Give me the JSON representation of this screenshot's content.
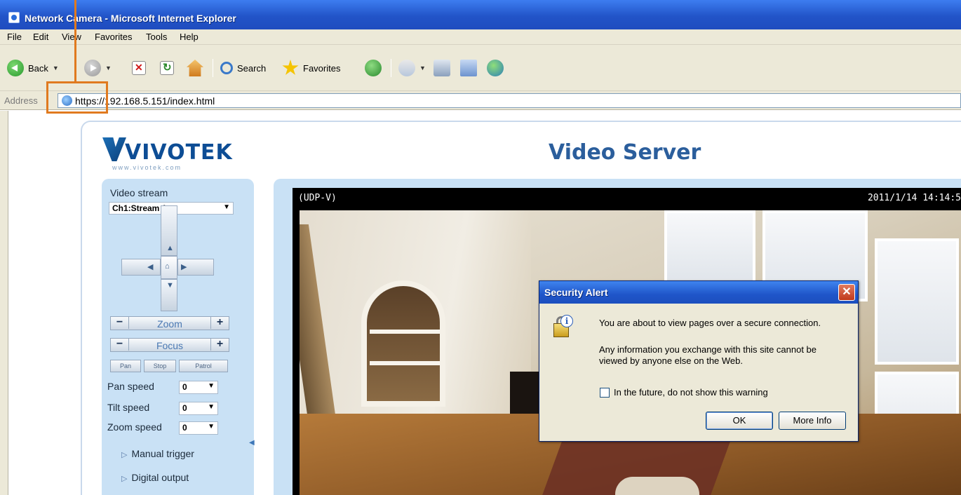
{
  "window": {
    "title": "Network Camera - Microsoft Internet Explorer"
  },
  "menu": [
    "File",
    "Edit",
    "View",
    "Favorites",
    "Tools",
    "Help"
  ],
  "toolbar": {
    "back_label": "Back",
    "search_label": "Search",
    "favorites_label": "Favorites"
  },
  "address": {
    "label": "Address",
    "url": "https://192.168.5.151/index.html"
  },
  "page": {
    "logo_text": "VIVOTEK",
    "logo_sub": "www.vivotek.com",
    "title": "Video Server"
  },
  "controls": {
    "video_stream_label": "Video stream",
    "stream_selected": "Ch1:Stream 1",
    "zoom_label": "Zoom",
    "focus_label": "Focus",
    "minus": "−",
    "plus": "+",
    "pan_button": "Pan",
    "stop_button": "Stop",
    "patrol_button": "Patrol",
    "pan_speed_label": "Pan speed",
    "pan_speed_value": "0",
    "tilt_speed_label": "Tilt speed",
    "tilt_speed_value": "0",
    "zoom_speed_label": "Zoom speed",
    "zoom_speed_value": "0",
    "manual_trigger": "Manual trigger",
    "digital_output": "Digital output"
  },
  "video": {
    "protocol": "(UDP-V)",
    "timestamp": "2011/1/14 14:14:5"
  },
  "dialog": {
    "title": "Security Alert",
    "line1": "You are about to view pages over a secure connection.",
    "line2a": "Any information you exchange with this site cannot be",
    "line2b": "viewed by anyone else on the Web.",
    "checkbox_label": "In the future, do not show this warning",
    "checkbox_checked": false,
    "ok_label": "OK",
    "more_info_label": "More Info"
  },
  "colors": {
    "callout": "#e07a1f",
    "titlebar": "#2254c8",
    "panel": "#c9e1f5"
  }
}
